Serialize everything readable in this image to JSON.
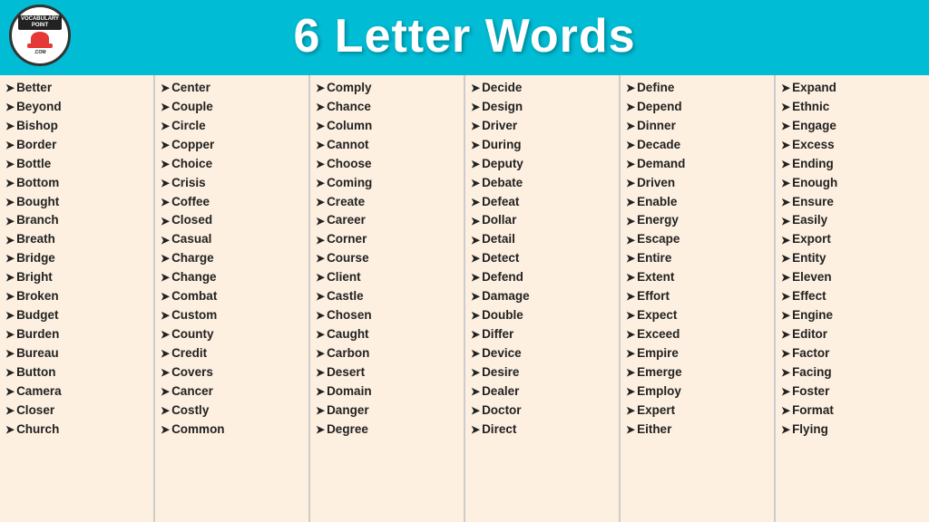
{
  "header": {
    "title": "6 Letter Words",
    "logo_line1": "VOCABULARY",
    "logo_line2": "POINT",
    "logo_line3": ".COM"
  },
  "columns": [
    {
      "id": "col1",
      "words": [
        "Better",
        "Beyond",
        "Bishop",
        "Border",
        "Bottle",
        "Bottom",
        "Bought",
        "Branch",
        "Breath",
        "Bridge",
        "Bright",
        "Broken",
        "Budget",
        "Burden",
        "Bureau",
        "Button",
        "Camera",
        "Closer",
        "Church"
      ]
    },
    {
      "id": "col2",
      "words": [
        "Center",
        "Couple",
        "Circle",
        "Copper",
        "Choice",
        "Crisis",
        "Coffee",
        "Closed",
        "Casual",
        "Charge",
        "Change",
        "Combat",
        "Custom",
        "County",
        "Credit",
        "Covers",
        "Cancer",
        "Costly",
        "Common"
      ]
    },
    {
      "id": "col3",
      "words": [
        "Comply",
        "Chance",
        "Column",
        "Cannot",
        "Choose",
        "Coming",
        "Create",
        "Career",
        "Corner",
        "Course",
        "Client",
        "Castle",
        "Chosen",
        "Caught",
        "Carbon",
        "Desert",
        "Domain",
        "Danger",
        "Degree"
      ]
    },
    {
      "id": "col4",
      "words": [
        "Decide",
        "Design",
        "Driver",
        "During",
        "Deputy",
        "Debate",
        "Defeat",
        "Dollar",
        "Detail",
        "Detect",
        "Defend",
        "Damage",
        "Double",
        "Differ",
        "Device",
        "Desire",
        "Dealer",
        "Doctor",
        "Direct"
      ]
    },
    {
      "id": "col5",
      "words": [
        "Define",
        "Depend",
        "Dinner",
        "Decade",
        "Demand",
        "Driven",
        "Enable",
        "Energy",
        "Escape",
        "Entire",
        "Extent",
        "Effort",
        "Expect",
        "Exceed",
        "Empire",
        "Emerge",
        "Employ",
        "Expert",
        "Either"
      ]
    },
    {
      "id": "col6",
      "words": [
        "Expand",
        "Ethnic",
        "Engage",
        "Excess",
        "Ending",
        "Enough",
        "Ensure",
        "Easily",
        "Export",
        "Entity",
        "Eleven",
        "Effect",
        "Engine",
        "Editor",
        "Factor",
        "Facing",
        "Foster",
        "Format",
        "Flying"
      ]
    }
  ]
}
